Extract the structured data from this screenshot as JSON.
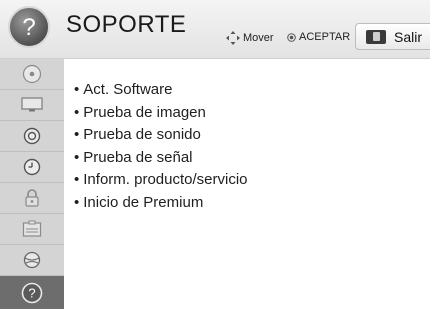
{
  "header": {
    "title": "SOPORTE",
    "hints": {
      "move_label": "Mover",
      "ok_label": "ACEPTAR",
      "exit_label": "Salir"
    }
  },
  "sidebar": {
    "items": [
      {
        "icon": "disc-icon",
        "active": false
      },
      {
        "icon": "tv-screen-icon",
        "active": false
      },
      {
        "icon": "speaker-icon",
        "active": false
      },
      {
        "icon": "clock-icon",
        "active": false
      },
      {
        "icon": "lock-icon",
        "active": false
      },
      {
        "icon": "options-box-icon",
        "active": false
      },
      {
        "icon": "network-globe-icon",
        "active": false
      },
      {
        "icon": "help-icon",
        "active": true
      }
    ]
  },
  "menu": {
    "items": [
      {
        "label": "Act. Software"
      },
      {
        "label": "Prueba de imagen"
      },
      {
        "label": "Prueba de sonido"
      },
      {
        "label": "Prueba de señal"
      },
      {
        "label": "Inform. producto/servicio"
      },
      {
        "label": "Inicio de Premium"
      }
    ]
  },
  "colors": {
    "sidebar_bg": "#d4d4d4",
    "sidebar_active": "#6d6d6d",
    "header_bg": "#ececec",
    "text": "#1f1f1f"
  }
}
